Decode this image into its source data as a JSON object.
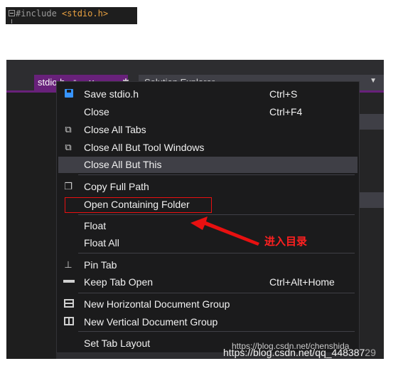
{
  "code": {
    "directive": "#include",
    "header": "<stdio.h>"
  },
  "ide": {
    "active_tab_label": "stdio.h",
    "solution_explorer_title": "Solution Explorer"
  },
  "menu": {
    "items": [
      {
        "label": "Save stdio.h",
        "shortcut": "Ctrl+S",
        "icon": "save-icon"
      },
      {
        "label": "Close",
        "shortcut": "Ctrl+F4"
      },
      {
        "label": "Close All Tabs",
        "shortcut": "",
        "icon": "close-tabs-icon"
      },
      {
        "label": "Close All But Tool Windows",
        "shortcut": "",
        "icon": "close-tabs-icon"
      },
      {
        "label": "Close All But This",
        "shortcut": "",
        "highlighted": true
      },
      {
        "label": "Copy Full Path",
        "shortcut": "",
        "icon": "copy-icon"
      },
      {
        "label": "Open Containing Folder",
        "shortcut": ""
      },
      {
        "label": "Float",
        "shortcut": ""
      },
      {
        "label": "Float All",
        "shortcut": ""
      },
      {
        "label": "Pin Tab",
        "shortcut": "",
        "icon": "pin-icon"
      },
      {
        "label": "Keep Tab Open",
        "shortcut": "Ctrl+Alt+Home",
        "icon": "keep-open-icon"
      },
      {
        "label": "New Horizontal Document Group",
        "shortcut": "",
        "icon": "horizontal-group-icon"
      },
      {
        "label": "New Vertical Document Group",
        "shortcut": "",
        "icon": "vertical-group-icon"
      },
      {
        "label": "Set Tab Layout",
        "shortcut": ""
      }
    ]
  },
  "annotation": {
    "text": "进入目录",
    "color": "#e81010"
  },
  "watermark": {
    "line1": "https://blog.csdn.net/chenshida",
    "line2_main": "https://blog.csdn.net/qq_448387",
    "line2_fade": "29"
  },
  "colors": {
    "menu_bg": "#1b1b1c",
    "menu_highlight": "#3f3f46",
    "tab_accent": "#68217a",
    "save_icon": "#3794ff"
  }
}
